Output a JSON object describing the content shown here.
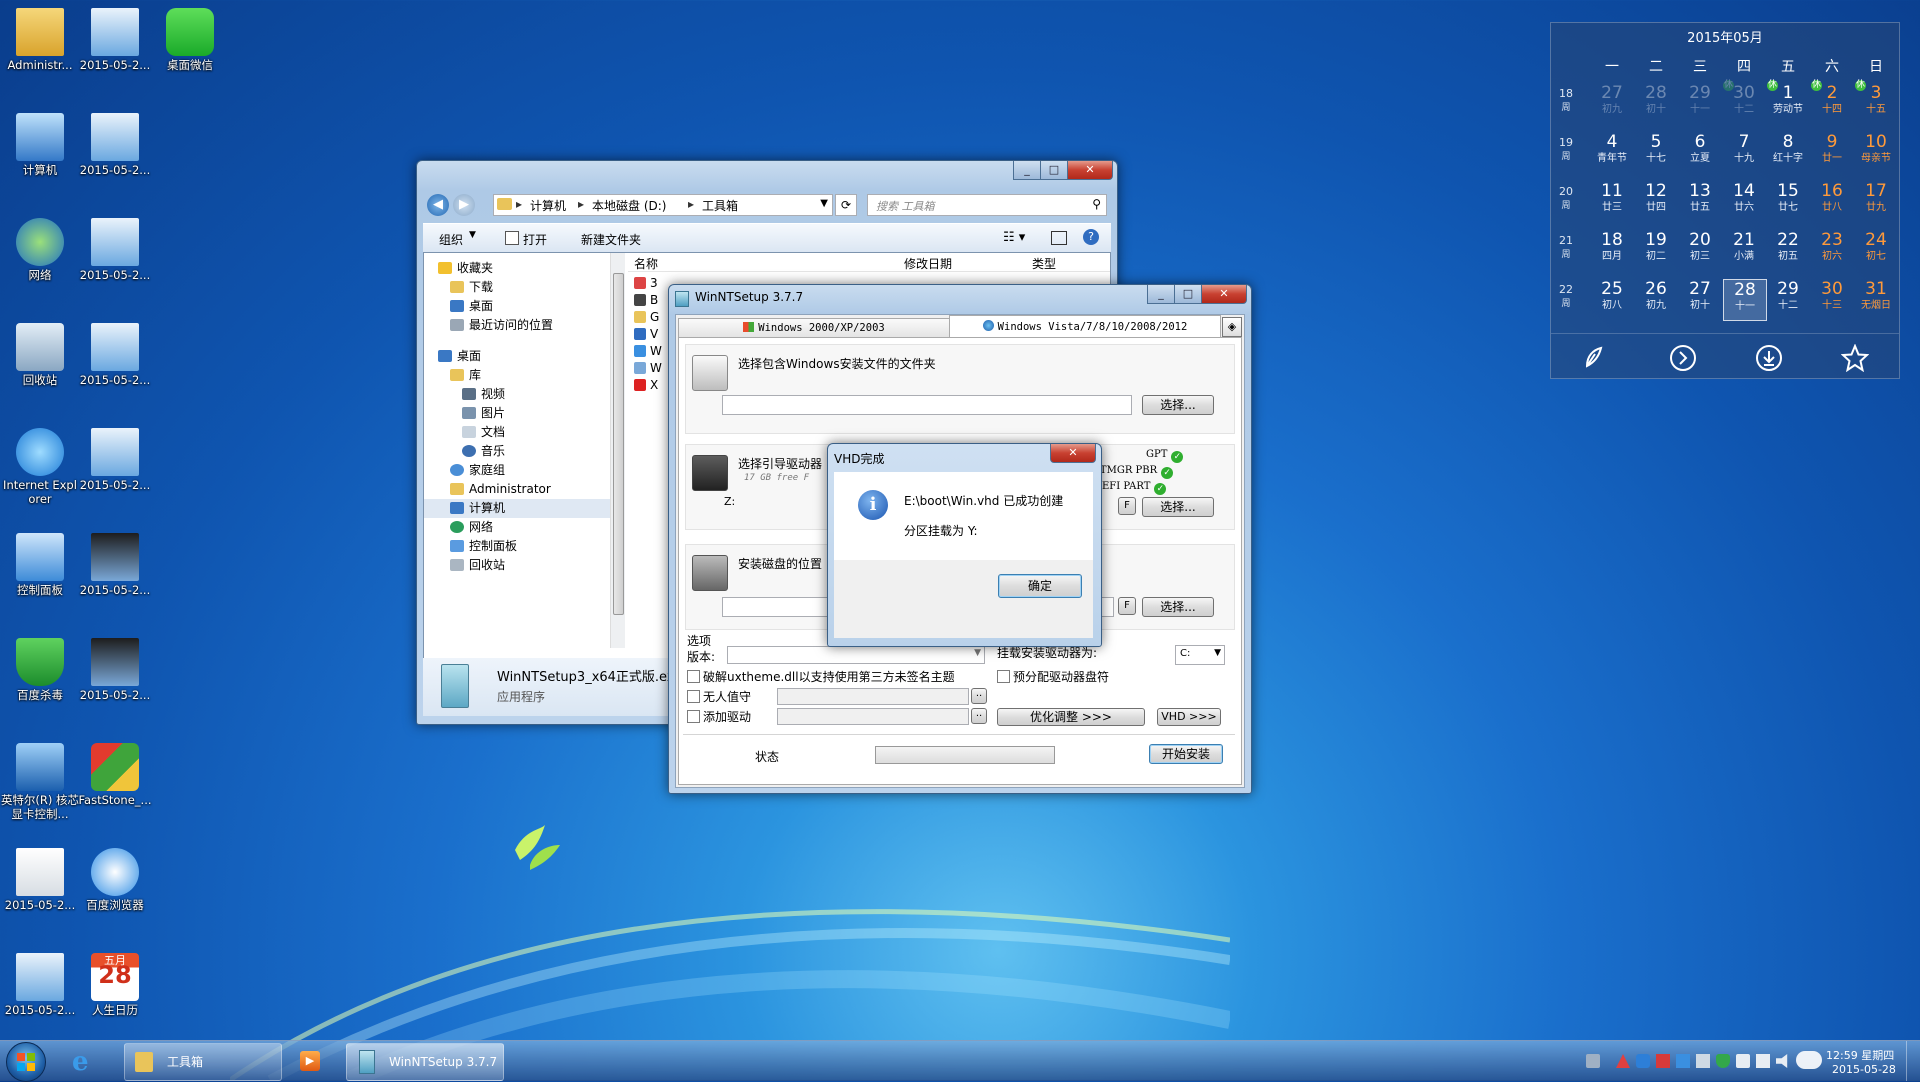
{
  "desktop": {
    "icons": [
      {
        "label": "Administr..."
      },
      {
        "label": "2015-05-2..."
      },
      {
        "label": "桌面微信"
      },
      {
        "label": "计算机"
      },
      {
        "label": "2015-05-2..."
      },
      {
        "label": "网络"
      },
      {
        "label": "2015-05-2..."
      },
      {
        "label": "回收站"
      },
      {
        "label": "2015-05-2..."
      },
      {
        "label": "Internet Explorer"
      },
      {
        "label": "2015-05-2..."
      },
      {
        "label": "控制面板"
      },
      {
        "label": "2015-05-2..."
      },
      {
        "label": "百度杀毒"
      },
      {
        "label": "2015-05-2..."
      },
      {
        "label": "英特尔(R) 核芯显卡控制..."
      },
      {
        "label": "FastStone_..."
      },
      {
        "label": "2015-05-2..."
      },
      {
        "label": "百度浏览器"
      },
      {
        "label": "2015-05-2..."
      },
      {
        "label": "人生日历"
      }
    ],
    "calendar_icon": {
      "month": "五月",
      "day": "28"
    }
  },
  "explorer": {
    "breadcrumb": [
      "计算机",
      "本地磁盘 (D:)",
      "工具箱"
    ],
    "search_placeholder": "搜索 工具箱",
    "toolbar": {
      "organize": "组织",
      "open": "打开",
      "new_folder": "新建文件夹"
    },
    "columns": {
      "name": "名称",
      "date": "修改日期",
      "type": "类型"
    },
    "nav": {
      "favorites": "收藏夹",
      "downloads": "下载",
      "desktop": "桌面",
      "recent": "最近访问的位置",
      "desktop2": "桌面",
      "library": "库",
      "videos": "视频",
      "pictures": "图片",
      "documents": "文档",
      "music": "音乐",
      "homegroup": "家庭组",
      "admin": "Administrator",
      "computer": "计算机",
      "network": "网络",
      "control": "控制面板",
      "recycle": "回收站"
    },
    "file_rows": [
      "3",
      "B",
      "G",
      "V",
      "W",
      "W",
      "X"
    ],
    "details": {
      "name": "WinNTSetup3_x64正式版.exe",
      "type": "应用程序"
    }
  },
  "winnt": {
    "title": "WinNTSetup 3.7.7",
    "tab_xp": "Windows 2000/XP/2003",
    "tab_vista": "Windows Vista/7/8/10/2008/2012",
    "sec1_label": "选择包含Windows安装文件的文件夹",
    "sec2_label": "选择引导驱动器",
    "sec2_free": "17 GB free F",
    "sec2_drive": "Z:",
    "sec3_label": "安装磁盘的位置",
    "choose": "选择...",
    "f": "F",
    "gpt": "GPT",
    "bootmgr": "BOOTMGR PBR",
    "efi": "EFI PART",
    "options": "选项",
    "version": "版本:",
    "mount_label": "挂载安装驱动器为:",
    "mount_value": "C:",
    "crack_theme": "破解uxtheme.dll以支持使用第三方未签名主题",
    "prealloc": "预分配驱动器盘符",
    "unattended": "无人值守",
    "add_driver": "添加驱动",
    "optimize": "优化调整 >>>",
    "vhd": "VHD >>>",
    "status": "状态",
    "start": "开始安装"
  },
  "dialog": {
    "title": "VHD完成",
    "message": "E:\\boot\\Win.vhd 已成功创建",
    "sub": "分区挂载为 Y:",
    "ok": "确定"
  },
  "calendar": {
    "title": "2015年05月",
    "weekdays": [
      "一",
      "二",
      "三",
      "四",
      "五",
      "六",
      "日"
    ],
    "week_label": "周",
    "weeks": [
      {
        "no": "18",
        "days": [
          {
            "d": "27",
            "l": "初九",
            "dim": true
          },
          {
            "d": "28",
            "l": "初十",
            "dim": true
          },
          {
            "d": "29",
            "l": "十一",
            "dim": true
          },
          {
            "d": "30",
            "l": "十二",
            "dim": true,
            "hol": true
          },
          {
            "d": "1",
            "l": "劳动节",
            "hol": true
          },
          {
            "d": "2",
            "l": "十四",
            "red": true,
            "hol": true
          },
          {
            "d": "3",
            "l": "十五",
            "red": true,
            "hol": true
          }
        ]
      },
      {
        "no": "19",
        "days": [
          {
            "d": "4",
            "l": "青年节"
          },
          {
            "d": "5",
            "l": "十七"
          },
          {
            "d": "6",
            "l": "立夏"
          },
          {
            "d": "7",
            "l": "十九"
          },
          {
            "d": "8",
            "l": "红十字"
          },
          {
            "d": "9",
            "l": "廿一",
            "red": true
          },
          {
            "d": "10",
            "l": "母亲节",
            "red": true
          }
        ]
      },
      {
        "no": "20",
        "days": [
          {
            "d": "11",
            "l": "廿三"
          },
          {
            "d": "12",
            "l": "廿四"
          },
          {
            "d": "13",
            "l": "廿五"
          },
          {
            "d": "14",
            "l": "廿六"
          },
          {
            "d": "15",
            "l": "廿七"
          },
          {
            "d": "16",
            "l": "廿八",
            "red": true
          },
          {
            "d": "17",
            "l": "廿九",
            "red": true
          }
        ]
      },
      {
        "no": "21",
        "days": [
          {
            "d": "18",
            "l": "四月"
          },
          {
            "d": "19",
            "l": "初二"
          },
          {
            "d": "20",
            "l": "初三"
          },
          {
            "d": "21",
            "l": "小满"
          },
          {
            "d": "22",
            "l": "初五"
          },
          {
            "d": "23",
            "l": "初六",
            "red": true
          },
          {
            "d": "24",
            "l": "初七",
            "red": true
          }
        ]
      },
      {
        "no": "22",
        "days": [
          {
            "d": "25",
            "l": "初八"
          },
          {
            "d": "26",
            "l": "初九"
          },
          {
            "d": "27",
            "l": "初十"
          },
          {
            "d": "28",
            "l": "十一",
            "today": true
          },
          {
            "d": "29",
            "l": "十二"
          },
          {
            "d": "30",
            "l": "十三",
            "red": true
          },
          {
            "d": "31",
            "l": "无烟日",
            "red": true
          }
        ]
      }
    ],
    "holiday_mark": "休"
  },
  "taskbar": {
    "explorer_label": "工具箱",
    "winnt_label": "WinNTSetup 3.7.7",
    "time": "12:59",
    "weekday": "星期四",
    "date": "2015-05-28"
  }
}
